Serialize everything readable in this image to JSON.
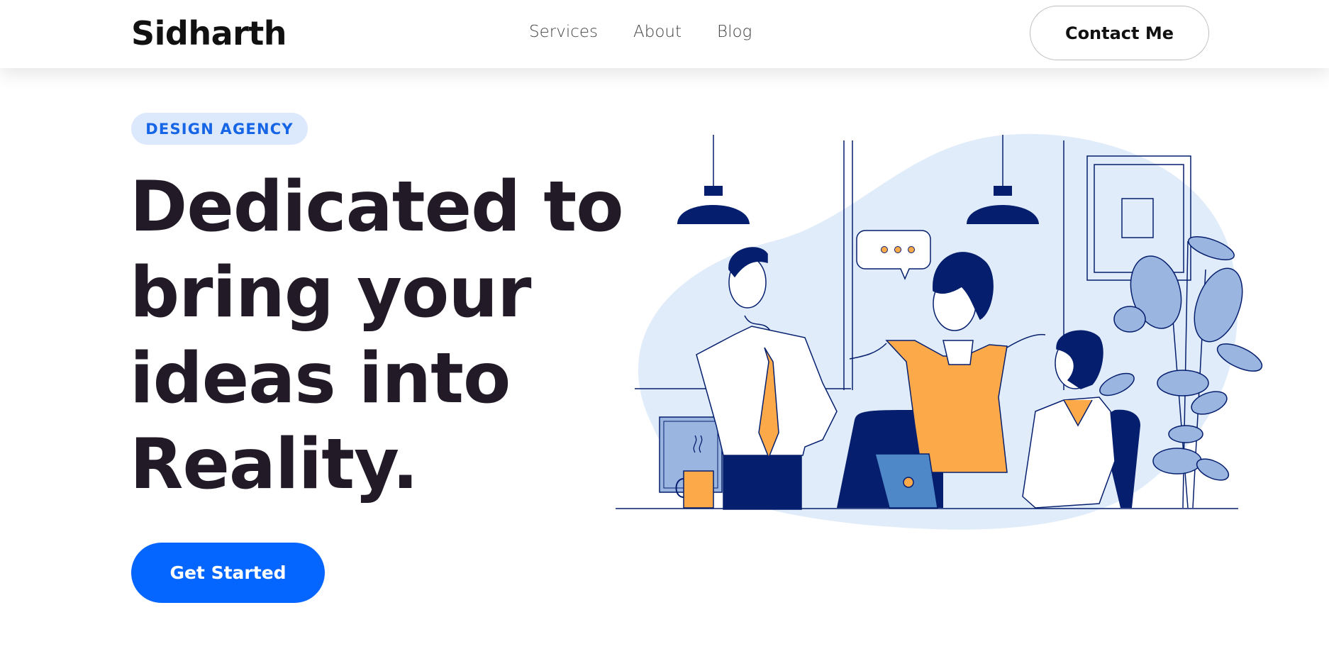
{
  "header": {
    "brand": "Sidharth",
    "nav": [
      {
        "label": "Services"
      },
      {
        "label": "About"
      },
      {
        "label": "Blog"
      }
    ],
    "contact_label": "Contact Me"
  },
  "hero": {
    "badge": "DESIGN AGENCY",
    "headline_lines": [
      "Dedicated to",
      "bring your",
      "ideas into",
      "Reality."
    ],
    "cta_label": "Get Started"
  },
  "colors": {
    "accent": "#0565ff",
    "badge_bg": "#dce8fb",
    "navy": "#051f6e",
    "orange": "#fca94a",
    "blob": "#e1ecfa"
  },
  "illustration": {
    "subject": "team-meeting-illustration",
    "speech_bubble_icon": "ellipsis-icon"
  }
}
